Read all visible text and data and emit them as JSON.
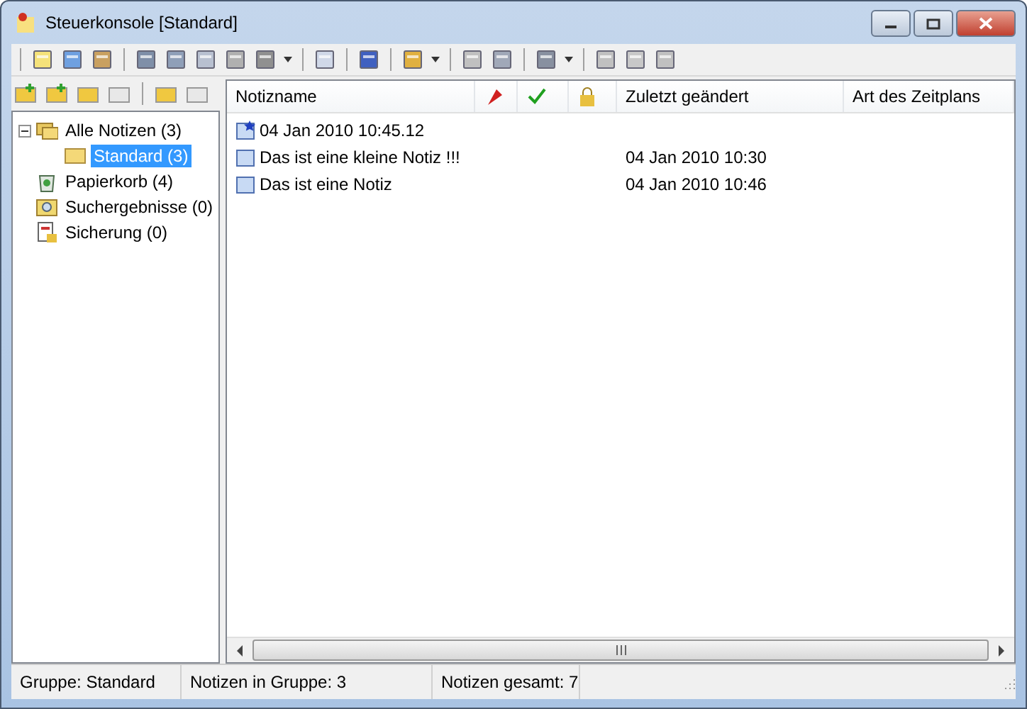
{
  "window": {
    "title": "Steuerkonsole [Standard]"
  },
  "tree": [
    {
      "label": "Alle Notizen (3)",
      "kind": "folders",
      "expanded": true,
      "selected": false,
      "children": [
        {
          "label": "Standard (3)",
          "kind": "folder",
          "selected": true
        }
      ]
    },
    {
      "label": "Papierkorb (4)",
      "kind": "trash",
      "selected": false
    },
    {
      "label": "Suchergebnisse (0)",
      "kind": "search",
      "selected": false
    },
    {
      "label": "Sicherung (0)",
      "kind": "backup",
      "selected": false
    }
  ],
  "table": {
    "columns": [
      {
        "kind": "text",
        "label": "Notizname"
      },
      {
        "kind": "flag"
      },
      {
        "kind": "check"
      },
      {
        "kind": "lock"
      },
      {
        "kind": "text",
        "label": "Zuletzt geändert"
      },
      {
        "kind": "text",
        "label": "Art des Zeitplans"
      }
    ],
    "rows": [
      {
        "kind": "new",
        "name": "04 Jan 2010  10:45.12"
      },
      {
        "kind": "note",
        "name": "Das ist eine kleine Notiz !!!",
        "modified": "04 Jan 2010  10:30"
      },
      {
        "kind": "note",
        "name": "Das ist eine Notiz",
        "modified": "04 Jan 2010  10:46"
      }
    ]
  },
  "status_bar": [
    "Gruppe: Standard",
    "Notizen in Gruppe: 3",
    "Notizen gesamt: 7"
  ]
}
